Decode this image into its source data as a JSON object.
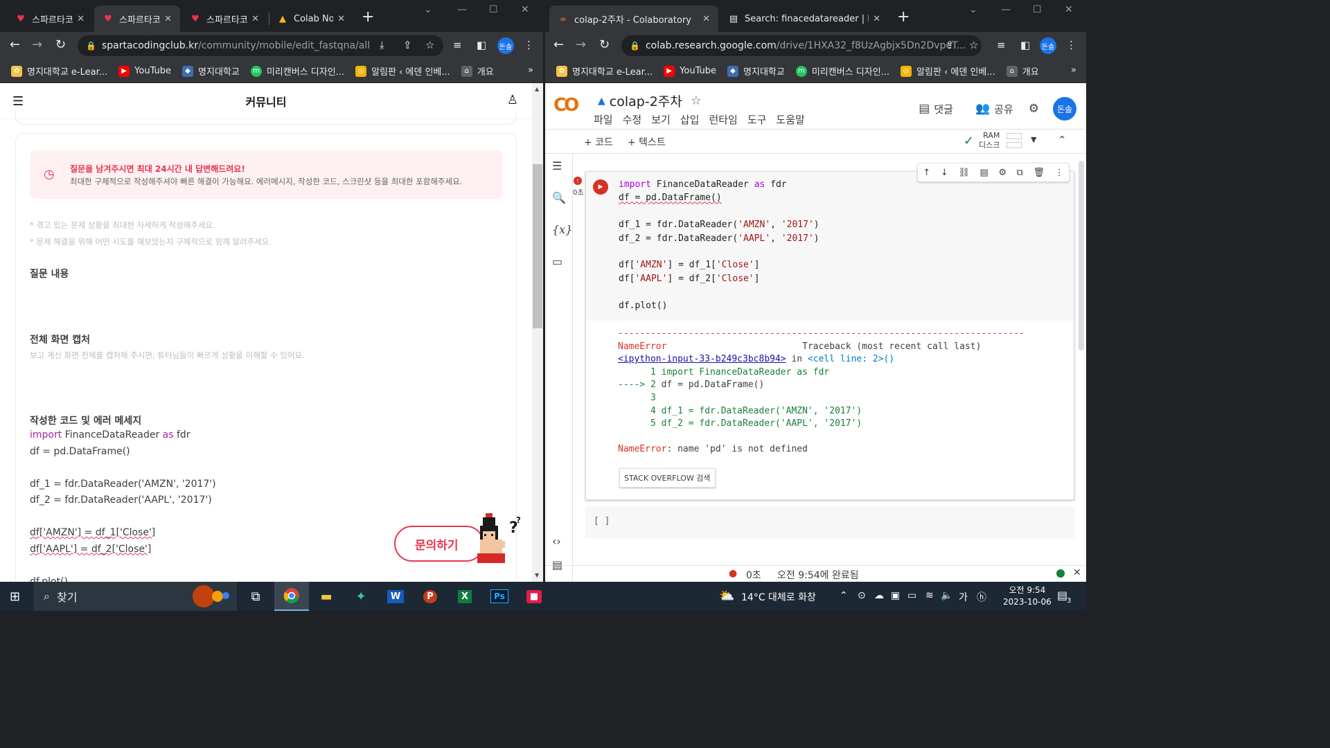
{
  "left_window": {
    "tabs": [
      {
        "title": "스파르타코",
        "close": "✕"
      },
      {
        "title": "스파르타코",
        "close": "✕"
      },
      {
        "title": "스파르타코",
        "close": "✕"
      },
      {
        "title": "Colab No",
        "close": "✕"
      }
    ],
    "url_host": "spartacodingclub.kr",
    "url_path": "/community/mobile/edit_fastqna/all",
    "avatar": "돈솔",
    "bookmarks": [
      "명지대학교 e-Lear...",
      "YouTube",
      "명지대학교",
      "미리캔버스 디자인...",
      "알림판 ‹ 에덴 인베...",
      "개요"
    ],
    "bookmarks_more": "»",
    "page": {
      "header_title": "커뮤니티",
      "notice_title": "질문을 남겨주시면 최대 24시간 내 답변해드려요!",
      "notice_body": "최대한 구체적으로 작성해주셔야 빠른 해결이 가능해요. 에러메시지, 작성한 코드, 스크린샷 등을 최대한 포함해주세요.",
      "hint1": "* 겪고 있는 문제 상황을 최대한 자세하게 작성해주세요.",
      "hint2": "* 문제 해결을 위해 어떤 시도를 해보았는지 구체적으로 함께 알려주세요.",
      "section_question": "질문 내용",
      "section_capture": "전체 화면 캡처",
      "capture_sub": "보고 계신 화면 전체를 캡처해 주시면, 튜터님들이 빠르게 상황을 이해할 수 있어요.",
      "section_code": "작성한 코드 및 에러 메세지",
      "code_lines": {
        "l1_kw": "import",
        "l1_mid": " FinanceDataReader ",
        "l1_kw2": "as",
        "l1_end": " fdr",
        "l2": "df = pd.DataFrame()",
        "l3": "df_1 = fdr.DataReader('AMZN', '2017')",
        "l4": "df_2 = fdr.DataReader('AAPL', '2017')",
        "l5": "df['AMZN'] = df_1['Close']",
        "l6": "df['AAPL'] = df_2['Close']",
        "l7": "df.plot()"
      },
      "ask_button": "문의하기"
    }
  },
  "right_window": {
    "tabs": [
      {
        "title": "colap-2주차 - Colaboratory",
        "close": "✕"
      },
      {
        "title": "Search: finacedatareader | Read",
        "close": "✕"
      }
    ],
    "url_host": "colab.research.google.com",
    "url_path": "/drive/1HXA32_f8UzAgbjx5Dn2DvpeT...",
    "avatar": "돈솔",
    "bookmarks": [
      "명지대학교 e-Lear...",
      "YouTube",
      "명지대학교",
      "미리캔버스 디자인...",
      "알림판 ‹ 에덴 인베...",
      "개요"
    ],
    "bookmarks_more": "»",
    "colab": {
      "logo": "CO",
      "notebook_title": "colap-2주차",
      "menu": [
        "파일",
        "수정",
        "보기",
        "삽입",
        "런타임",
        "도구",
        "도움말"
      ],
      "comment": "댓글",
      "share": "공유",
      "avatar": "돈솔",
      "add_code": "+ 코드",
      "add_text": "+ 텍스트",
      "ram": "RAM",
      "disk": "디스크",
      "exec_time": "0초",
      "code": {
        "l1_kw": "import",
        "l1_mid": " FinanceDataReader ",
        "l1_kw2": "as",
        "l1_end": " fdr",
        "l2": "df = pd.DataFrame()",
        "l3a": "df_1 = fdr.DataReader(",
        "l3b": "'AMZN'",
        "l3c": ", ",
        "l3d": "'2017'",
        "l3e": ")",
        "l4a": "df_2 = fdr.DataReader(",
        "l4b": "'AAPL'",
        "l4c": ", ",
        "l4d": "'2017'",
        "l4e": ")",
        "l5a": "df[",
        "l5b": "'AMZN'",
        "l5c": "] = df_1[",
        "l5d": "'Close'",
        "l5e": "]",
        "l6a": "df[",
        "l6b": "'AAPL'",
        "l6c": "] = df_2[",
        "l6d": "'Close'",
        "l6e": "]",
        "l7": "df.plot()"
      },
      "output": {
        "rule": "---------------------------------------------------------------------------",
        "err_name": "NameError",
        "traceback": "                         Traceback (most recent call last)",
        "link": "<ipython-input-33-b249c3bc8b94>",
        "in": " in ",
        "cell_line": "<cell line: 2>()",
        "t1": "      1 import FinanceDataReader as fdr",
        "t2_arrow": "----> 2",
        "t2": " df = pd.DataFrame()",
        "t3": "      3",
        "t4": "      4 df_1 = fdr.DataReader('AMZN', '2017')",
        "t5": "      5 df_2 = fdr.DataReader('AAPL', '2017')",
        "final_name": "NameError",
        "final_msg": ": name 'pd' is not defined"
      },
      "stackoverflow": "STACK OVERFLOW 검색",
      "empty_cell": "[ ]",
      "status_time": "0초",
      "status_done": "오전 9:54에 완료됨"
    }
  },
  "taskbar": {
    "search": "찾기",
    "weather": "14°C  대체로 화창",
    "ime": "가",
    "time": "오전 9:54",
    "date": "2023-10-06",
    "notif_count": "3"
  }
}
